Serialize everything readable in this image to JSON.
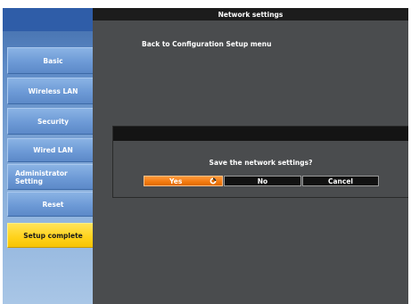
{
  "main": {
    "title": "Network settings",
    "back_link": "Back to Configuration Setup menu"
  },
  "sidebar": {
    "items": [
      {
        "label": "Basic",
        "active": false
      },
      {
        "label": "Wireless LAN",
        "active": false
      },
      {
        "label": "Security",
        "active": false
      },
      {
        "label": "Wired LAN",
        "active": false
      },
      {
        "label_line1": "Administrator",
        "label_line2": "Setting",
        "active": false
      },
      {
        "label": "Reset",
        "active": false
      },
      {
        "label": "Setup complete",
        "active": true
      }
    ]
  },
  "dialog": {
    "message": "Save the network settings?",
    "yes_label": "Yes",
    "no_label": "No",
    "cancel_label": "Cancel",
    "yes_icon": "check-circle-icon"
  },
  "colors": {
    "accent_selected": "#f27a10",
    "sidebar_active": "#ffd21a",
    "sidebar_blue": "#6d9ad6"
  }
}
